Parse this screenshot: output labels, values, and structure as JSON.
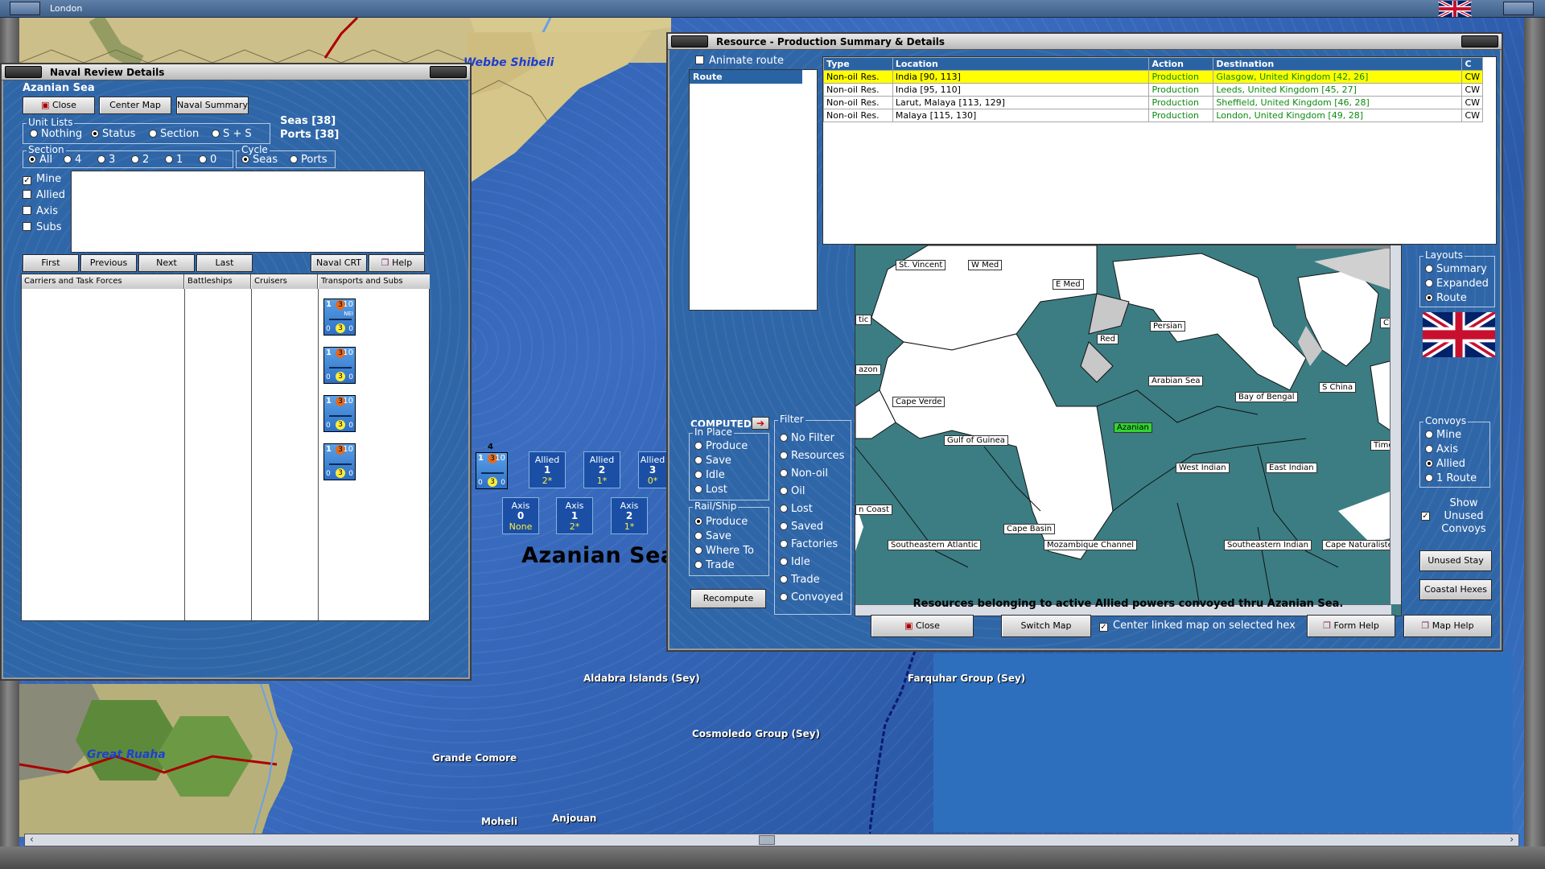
{
  "titlebar": {
    "title": "London"
  },
  "map": {
    "sea_name": "Azanian Sea",
    "labels": {
      "webbe_shibeli": "Webbe Shibeli",
      "great_ruaha": "Great Ruaha",
      "aldabra": "Aldabra Islands (Sey)",
      "cosmoledo": "Cosmoledo Group (Sey)",
      "farquhar": "Farquhar Group (Sey)",
      "grande_comore": "Grande Comore",
      "moheli": "Moheli",
      "anjouan": "Anjouan"
    },
    "stacks": [
      {
        "side": "Allied",
        "count": "1",
        "note": "2*"
      },
      {
        "side": "Allied",
        "count": "2",
        "note": "1*"
      },
      {
        "side": "Allied",
        "count": "3",
        "note": "0*"
      },
      {
        "side": "Axis",
        "count": "0",
        "note": "None"
      },
      {
        "side": "Axis",
        "count": "1",
        "note": "2*"
      },
      {
        "side": "Axis",
        "count": "2",
        "note": "1*"
      }
    ],
    "map_unit": {
      "top": "1",
      "mid": "3",
      "right": "10",
      "bottom": "3",
      "bl": "0",
      "br": "0",
      "badge": "4"
    }
  },
  "naval": {
    "title": "Naval Review Details",
    "location": "Azanian Sea",
    "buttons": {
      "close": "Close",
      "center_map": "Center Map",
      "naval_summary": "Naval Summary"
    },
    "seas": "Seas [38]",
    "ports": "Ports [38]",
    "unit_lists": {
      "title": "Unit Lists",
      "options": [
        "Nothing",
        "Status",
        "Section",
        "S + S"
      ],
      "selected": "Status"
    },
    "section": {
      "title": "Section",
      "options": [
        "All",
        "4",
        "3",
        "2",
        "1",
        "0"
      ],
      "selected": "All"
    },
    "cycle": {
      "title": "Cycle",
      "options": [
        "Seas",
        "Ports"
      ],
      "selected": "Seas"
    },
    "filters": [
      {
        "label": "Mine",
        "checked": true
      },
      {
        "label": "Allied",
        "checked": false
      },
      {
        "label": "Axis",
        "checked": false
      },
      {
        "label": "Subs",
        "checked": false
      }
    ],
    "nav": {
      "first": "First",
      "previous": "Previous",
      "next": "Next",
      "last": "Last",
      "naval_crt": "Naval CRT",
      "help": "Help"
    },
    "columns": [
      "Carriers and Task Forces",
      "Battleships",
      "Cruisers",
      "Transports and Subs"
    ],
    "units": [
      {
        "top": "1",
        "mid": "3",
        "right": "10",
        "bottom": "3",
        "bl": "0",
        "br": "0",
        "tag": "NEI"
      },
      {
        "top": "1",
        "mid": "3",
        "right": "10",
        "bottom": "3",
        "bl": "0",
        "br": "0",
        "tag": ""
      },
      {
        "top": "1",
        "mid": "3",
        "right": "10",
        "bottom": "3",
        "bl": "0",
        "br": "0",
        "tag": ""
      },
      {
        "top": "1",
        "mid": "3",
        "right": "10",
        "bottom": "3",
        "bl": "0",
        "br": "0",
        "tag": ""
      }
    ]
  },
  "resource": {
    "title": "Resource - Production Summary & Details",
    "animate_route": "Animate route",
    "route_header": "Route",
    "table": {
      "headers": [
        "Type",
        "Location",
        "Action",
        "Destination",
        "C"
      ],
      "rows": [
        [
          "Non-oil Res.",
          "India [90, 113]",
          "Production",
          "Glasgow, United Kingdom [42, 26]",
          "CW"
        ],
        [
          "Non-oil Res.",
          "India [95, 110]",
          "Production",
          "Leeds, United Kingdom [45, 27]",
          "CW"
        ],
        [
          "Non-oil Res.",
          "Larut, Malaya [113, 129]",
          "Production",
          "Sheffield, United Kingdom [46, 28]",
          "CW"
        ],
        [
          "Non-oil Res.",
          "Malaya [115, 130]",
          "Production",
          "London, United Kingdom [49, 28]",
          "CW"
        ]
      ]
    },
    "computed": "COMPUTED",
    "in_place": {
      "title": "In Place",
      "options": [
        "Produce",
        "Save",
        "Idle",
        "Lost"
      ]
    },
    "rail_ship": {
      "title": "Rail/Ship",
      "options": [
        "Produce",
        "Save",
        "Where To",
        "Trade"
      ],
      "selected": "Produce"
    },
    "filter": {
      "title": "Filter",
      "options": [
        "No Filter",
        "Resources",
        "Non-oil",
        "Oil",
        "Lost",
        "Saved",
        "Factories",
        "Idle",
        "Trade",
        "Convoyed"
      ]
    },
    "recompute": "Recompute",
    "layouts": {
      "title": "Layouts",
      "options": [
        "Summary",
        "Expanded",
        "Route"
      ],
      "selected": "Route"
    },
    "convoys": {
      "title": "Convoys",
      "options": [
        "Mine",
        "Axis",
        "Allied",
        "1 Route"
      ],
      "selected": "Allied"
    },
    "show_unused": {
      "label": "Show Unused Convoys",
      "checked": true
    },
    "unused_stay": "Unused Stay",
    "coastal_hexes": "Coastal Hexes",
    "status": "Resources belonging to active Allied powers convoyed thru Azanian Sea.",
    "close": "Close",
    "switch_map": "Switch Map",
    "center_linked": "Center linked map on selected hex",
    "form_help": "Form Help",
    "map_help": "Map Help",
    "minimap_labels": {
      "st_vincent": "St. Vincent",
      "w_med": "W Med",
      "e_med": "E Med",
      "persian": "Persian",
      "red": "Red",
      "arabian": "Arabian Sea",
      "bay_bengal": "Bay of Bengal",
      "s_china": "S China",
      "cape_verde": "Cape Verde",
      "gulf_guinea": "Gulf of Guinea",
      "azanian": "Azanian",
      "west_indian": "West Indian",
      "east_indian": "East Indian",
      "timor": "Timor",
      "coast": "n Coast",
      "cape_basin": "Cape Basin",
      "se_atlantic": "Southeastern Atlantic",
      "mozambique": "Mozambique Channel",
      "se_indian": "Southeastern Indian",
      "cape_nat": "Cape Naturaliste",
      "chi": "Chi",
      "azon": "azon",
      "tic": "tic"
    }
  }
}
